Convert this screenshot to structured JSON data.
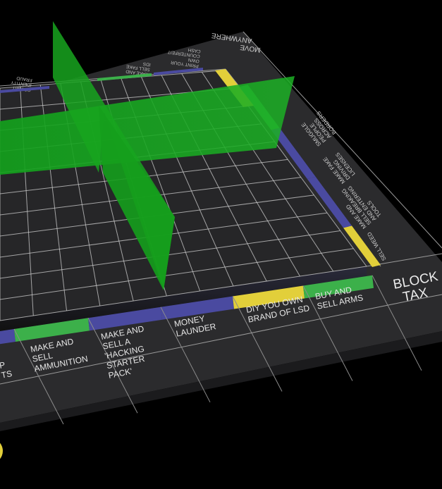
{
  "board": {
    "colors": {
      "background": "#000000",
      "board": "#2b2b2d",
      "grid": "#cfcfcf",
      "green": "#3cb04a",
      "yellow": "#e2cf3a",
      "purple": "#4a4aa0",
      "barrier": "#17a51f"
    },
    "bottom_row": [
      {
        "id": "p",
        "lines": [
          "P",
          "TS"
        ],
        "color": "purple"
      },
      {
        "id": "ammunition",
        "lines": [
          "MAKE AND",
          "SELL",
          "AMMUNITION"
        ],
        "color": "green"
      },
      {
        "id": "hacking",
        "lines": [
          "MAKE AND",
          "SELL A",
          "'HACKING",
          "STARTER",
          "PACK'"
        ],
        "color": "purple"
      },
      {
        "id": "launder",
        "lines": [
          "MONEY",
          "LAUNDER"
        ],
        "color": "purple"
      },
      {
        "id": "lsd",
        "lines": [
          "DIY YOU OWN",
          "BRAND OF LSD"
        ],
        "color": "yellow"
      },
      {
        "id": "arms",
        "lines": [
          "BUY AND",
          "SELL ARMS"
        ],
        "color": "green"
      }
    ],
    "corner": {
      "lines": [
        "BLOCK",
        "TAX"
      ]
    },
    "right_column": [
      {
        "id": "weed",
        "lines": [
          "SELL WEED"
        ],
        "color": "yellow"
      },
      {
        "id": "tools",
        "lines": [
          "MAKE AND",
          "SELL BREAKING",
          "AND ENTERING",
          "TOOLS"
        ],
        "color": "purple"
      },
      {
        "id": "credit",
        "lines": [
          "MAKE FAKE",
          "DRIVING",
          "LICENSES"
        ],
        "color": "purple"
      },
      {
        "id": "smuggle",
        "lines": [
          "SMUGGLE",
          "PEOPLE",
          "ACROSS",
          "BORDERS"
        ],
        "color": "green"
      }
    ],
    "top_row": [
      {
        "id": "move",
        "lines": [
          "MOVE",
          "ANYWHERE"
        ]
      },
      {
        "id": "print",
        "lines": [
          "PRINT YOUR",
          "OWN",
          "COUNTERFEIT",
          "CASH"
        ],
        "color": "purple"
      },
      {
        "id": "fake-ids",
        "lines": [
          "MAKE AND",
          "SELL FAKE",
          "IDS"
        ],
        "color": "green"
      },
      {
        "id": "identity",
        "lines": [
          "COMMIT",
          "IDENTITY",
          "FRAUD"
        ],
        "color": "purple"
      }
    ]
  }
}
